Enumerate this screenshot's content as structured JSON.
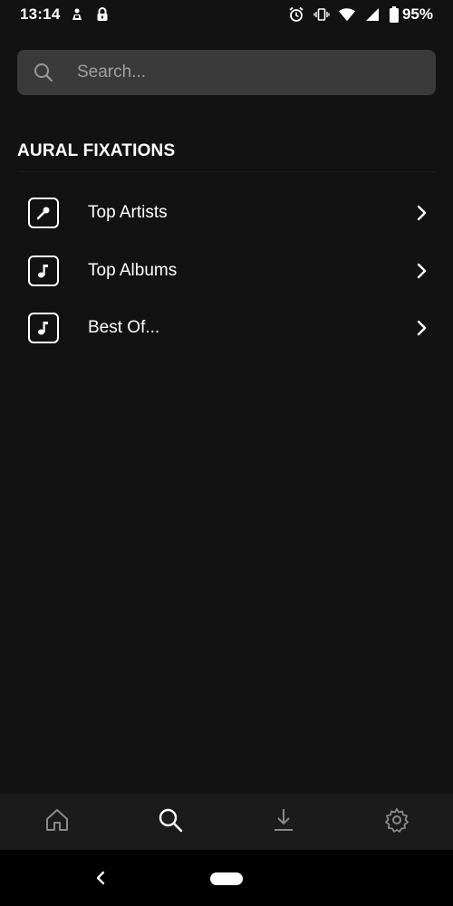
{
  "status_bar": {
    "time": "13:14",
    "battery_percent": "95%",
    "left_icons": [
      "notification-app-icon",
      "lock-icon"
    ],
    "right_icons": [
      "alarm-icon",
      "vibrate-icon",
      "wifi-icon",
      "signal-icon",
      "battery-icon"
    ]
  },
  "search": {
    "placeholder": "Search...",
    "value": ""
  },
  "section": {
    "title": "AURAL FIXATIONS",
    "items": [
      {
        "label": "Top Artists",
        "icon": "microphone-icon"
      },
      {
        "label": "Top Albums",
        "icon": "music-note-icon"
      },
      {
        "label": "Best Of...",
        "icon": "music-note-icon"
      }
    ]
  },
  "bottom_nav": {
    "items": [
      {
        "icon": "home-icon",
        "active": false
      },
      {
        "icon": "search-icon",
        "active": true
      },
      {
        "icon": "download-icon",
        "active": false
      },
      {
        "icon": "settings-icon",
        "active": false
      }
    ]
  },
  "colors": {
    "background": "#121212",
    "search_bg": "#3a3a3a",
    "nav_bg": "#1b1b1b",
    "inactive_icon": "#8a8a8a",
    "active_icon": "#ffffff"
  }
}
